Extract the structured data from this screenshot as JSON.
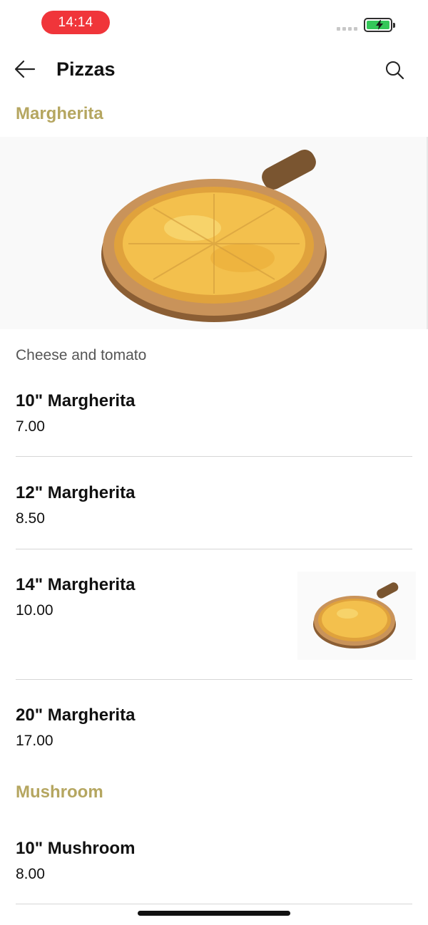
{
  "status_bar": {
    "time": "14:14"
  },
  "header": {
    "title": "Pizzas"
  },
  "sections": [
    {
      "title": "Margherita",
      "description": "Cheese and tomato",
      "items": [
        {
          "name": "10\" Margherita",
          "price": "7.00"
        },
        {
          "name": "12\" Margherita",
          "price": "8.50"
        },
        {
          "name": "14\" Margherita",
          "price": "10.00"
        },
        {
          "name": "20\" Margherita",
          "price": "17.00"
        }
      ]
    },
    {
      "title": "Mushroom",
      "items": [
        {
          "name": "10\" Mushroom",
          "price": "8.00"
        }
      ]
    }
  ],
  "icons": {
    "back": "back-arrow-icon",
    "search": "search-icon",
    "battery": "battery-charging-icon"
  },
  "colors": {
    "accent": "#b5a660",
    "time_pill": "#f0353a",
    "battery": "#34c759"
  }
}
